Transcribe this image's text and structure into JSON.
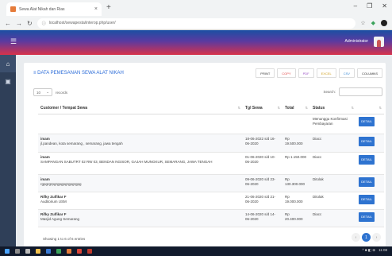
{
  "browser": {
    "tab_title": "Sewa Alat Nikah dan Rias",
    "tab_close": "×",
    "new_tab": "+",
    "url": "localhost/sewapesta/interop.php/user/",
    "win_min": "–",
    "win_max": "❐",
    "win_close": "✕"
  },
  "header": {
    "admin_label": "Administrator"
  },
  "page": {
    "title": "DATA PEMESANAN SEWA ALAT NIKAH",
    "buttons": {
      "print": "PRINT",
      "copy": "COPY",
      "pdf": "PDF",
      "excel": "EXCEL",
      "csv": "CSV",
      "columns": "COLUMNS"
    },
    "length_value": "10",
    "length_suffix": "records",
    "search_label": "Search:",
    "columns": [
      "Customer / Tempat Sewa",
      "Tgl Sewa",
      "Total",
      "Status",
      ""
    ],
    "rows": [
      {
        "name": "",
        "address": "",
        "date": "",
        "total": "",
        "status": "Menunggu Konfirmasi Pembayaran",
        "action": "DETAIL"
      },
      {
        "name": "imam",
        "address": "jl.pandean, kota semarang , semarang, jawa tengah",
        "date": "18-06-2022 s/d 16-06-2020",
        "total": "Rp 19.500.000",
        "status": "Diacc",
        "action": "DETAIL"
      },
      {
        "name": "imam",
        "address": "SAMPANGAN SABUTRT 02 RW 03, BENDAN NGISOR, GAJAH MUNGKUR, SEMARANG, JAWA TENGAH",
        "date": "01-06-2020 s/d 10-06-2020",
        "total": "Rp 1.150.000",
        "status": "Diacc",
        "action": "DETAIL"
      },
      {
        "name": "imam",
        "address": "rgpgrgrpgrgpgpgrgpgrgpg",
        "date": "09-06-2020 s/d 23-06-2020",
        "total": "Rp 130.300.000",
        "status": "Ditolak",
        "action": "DETAIL"
      },
      {
        "name": "Rifky Zulfikar F",
        "address": "Auditorium USM",
        "date": "21-06-2020 s/d 21-06-2020",
        "total": "Rp 19.000.000",
        "status": "Ditolak",
        "action": "DETAIL"
      },
      {
        "name": "Rifky Zulfikar F",
        "address": "Masjid Agung Semarang",
        "date": "14-06-2020 s/d 14-06-2020",
        "total": "Rp 20.400.000",
        "status": "Diacc",
        "action": "DETAIL"
      }
    ],
    "info": "Showing 1 to 6 of 6 entries",
    "pager": {
      "prev": "‹",
      "current": "1",
      "next": "›"
    }
  },
  "taskbar": {
    "clock": "11:08",
    "tray": "^ ■ ◧ ⊕"
  }
}
